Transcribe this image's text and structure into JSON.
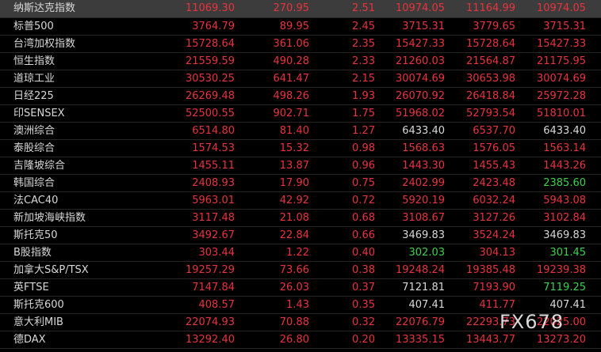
{
  "rows": [
    {
      "name": "纳斯达克指数",
      "last": "11069.30",
      "change": "270.95",
      "pct": "2.51",
      "open": "10974.05",
      "high": "11164.99",
      "low": "10974.05",
      "c": [
        "up",
        "up",
        "up",
        "up",
        "up",
        "up"
      ],
      "selected": true
    },
    {
      "name": "标普500",
      "last": "3764.79",
      "change": "89.95",
      "pct": "2.45",
      "open": "3715.31",
      "high": "3779.65",
      "low": "3715.31",
      "c": [
        "up",
        "up",
        "up",
        "up",
        "up",
        "up"
      ]
    },
    {
      "name": "台湾加权指数",
      "last": "15728.64",
      "change": "361.06",
      "pct": "2.35",
      "open": "15427.33",
      "high": "15728.64",
      "low": "15427.33",
      "c": [
        "up",
        "up",
        "up",
        "up",
        "up",
        "up"
      ]
    },
    {
      "name": "恒生指数",
      "last": "21559.59",
      "change": "490.28",
      "pct": "2.33",
      "open": "21260.03",
      "high": "21564.87",
      "low": "21175.95",
      "c": [
        "up",
        "up",
        "up",
        "up",
        "up",
        "up"
      ]
    },
    {
      "name": "道琼工业",
      "last": "30530.25",
      "change": "641.47",
      "pct": "2.15",
      "open": "30074.69",
      "high": "30653.98",
      "low": "30074.69",
      "c": [
        "up",
        "up",
        "up",
        "up",
        "up",
        "up"
      ]
    },
    {
      "name": "日经225",
      "last": "26269.48",
      "change": "498.26",
      "pct": "1.93",
      "open": "26070.92",
      "high": "26418.84",
      "low": "25972.28",
      "c": [
        "up",
        "up",
        "up",
        "up",
        "up",
        "up"
      ]
    },
    {
      "name": "印SENSEX",
      "last": "52500.55",
      "change": "902.71",
      "pct": "1.75",
      "open": "51968.02",
      "high": "52793.54",
      "low": "51810.01",
      "c": [
        "up",
        "up",
        "up",
        "up",
        "up",
        "up"
      ]
    },
    {
      "name": "澳洲综合",
      "last": "6514.80",
      "change": "81.40",
      "pct": "1.27",
      "open": "6433.40",
      "high": "6537.70",
      "low": "6433.40",
      "c": [
        "up",
        "up",
        "up",
        "flat",
        "up",
        "flat"
      ]
    },
    {
      "name": "泰股综合",
      "last": "1574.53",
      "change": "15.32",
      "pct": "0.98",
      "open": "1568.63",
      "high": "1576.05",
      "low": "1563.14",
      "c": [
        "up",
        "up",
        "up",
        "up",
        "up",
        "up"
      ]
    },
    {
      "name": "吉隆坡综合",
      "last": "1455.11",
      "change": "13.87",
      "pct": "0.96",
      "open": "1443.30",
      "high": "1455.43",
      "low": "1443.26",
      "c": [
        "up",
        "up",
        "up",
        "up",
        "up",
        "up"
      ]
    },
    {
      "name": "韩国综合",
      "last": "2408.93",
      "change": "17.90",
      "pct": "0.75",
      "open": "2402.99",
      "high": "2423.48",
      "low": "2385.60",
      "c": [
        "up",
        "up",
        "up",
        "up",
        "up",
        "down"
      ]
    },
    {
      "name": "法CAC40",
      "last": "5963.01",
      "change": "42.92",
      "pct": "0.72",
      "open": "5920.19",
      "high": "6032.24",
      "low": "5943.08",
      "c": [
        "up",
        "up",
        "up",
        "up",
        "up",
        "up"
      ]
    },
    {
      "name": "新加坡海峡指数",
      "last": "3117.48",
      "change": "21.08",
      "pct": "0.68",
      "open": "3108.67",
      "high": "3127.26",
      "low": "3102.84",
      "c": [
        "up",
        "up",
        "up",
        "up",
        "up",
        "up"
      ]
    },
    {
      "name": "斯托克50",
      "last": "3492.67",
      "change": "22.84",
      "pct": "0.66",
      "open": "3469.83",
      "high": "3524.24",
      "low": "3469.83",
      "c": [
        "up",
        "up",
        "up",
        "flat",
        "up",
        "flat"
      ]
    },
    {
      "name": "B股指数",
      "last": "303.44",
      "change": "1.22",
      "pct": "0.40",
      "open": "302.03",
      "high": "304.13",
      "low": "301.45",
      "c": [
        "up",
        "up",
        "up",
        "down",
        "up",
        "down"
      ]
    },
    {
      "name": "加拿大S&P/TSX",
      "last": "19257.29",
      "change": "73.66",
      "pct": "0.38",
      "open": "19248.24",
      "high": "19385.48",
      "low": "19239.38",
      "c": [
        "up",
        "up",
        "up",
        "up",
        "up",
        "up"
      ]
    },
    {
      "name": "英FTSE",
      "last": "7147.84",
      "change": "26.03",
      "pct": "0.37",
      "open": "7121.81",
      "high": "7193.90",
      "low": "7119.25",
      "c": [
        "up",
        "up",
        "up",
        "flat",
        "up",
        "down"
      ]
    },
    {
      "name": "斯托克600",
      "last": "408.57",
      "change": "1.43",
      "pct": "0.35",
      "open": "407.41",
      "high": "411.77",
      "low": "407.41",
      "c": [
        "up",
        "up",
        "up",
        "flat",
        "up",
        "flat"
      ]
    },
    {
      "name": "意大利MIB",
      "last": "22074.93",
      "change": "70.88",
      "pct": "0.32",
      "open": "22076.79",
      "high": "22293.73",
      "low": "22025.00",
      "c": [
        "up",
        "up",
        "up",
        "up",
        "up",
        "up"
      ]
    },
    {
      "name": "德DAX",
      "last": "13292.40",
      "change": "26.80",
      "pct": "0.20",
      "open": "13335.15",
      "high": "13443.77",
      "low": "13273.20",
      "c": [
        "up",
        "up",
        "up",
        "up",
        "up",
        "up"
      ]
    }
  ],
  "watermark": "FX678"
}
